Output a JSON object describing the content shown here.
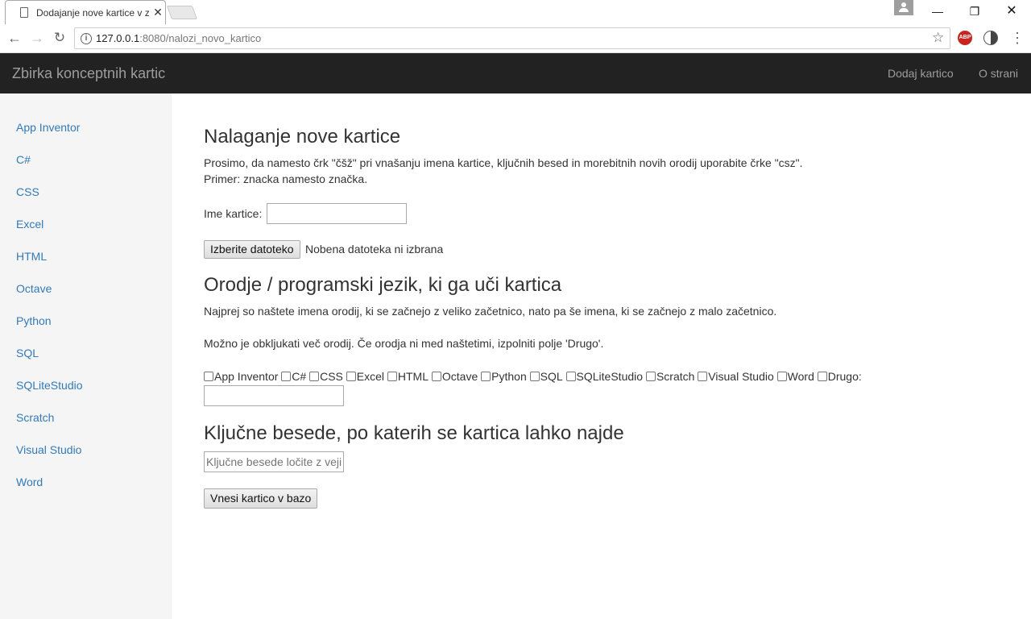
{
  "browser": {
    "tab_title": "Dodajanje nove kartice v zbirko",
    "url_host": "127.0.0.1",
    "url_path": ":8080/nalozi_novo_kartico"
  },
  "navbar": {
    "brand": "Zbirka konceptnih kartic",
    "links": [
      "Dodaj kartico",
      "O strani"
    ]
  },
  "sidebar": {
    "items": [
      "App Inventor",
      "C#",
      "CSS",
      "Excel",
      "HTML",
      "Octave",
      "Python",
      "SQL",
      "SQLiteStudio",
      "Scratch",
      "Visual Studio",
      "Word"
    ]
  },
  "form": {
    "heading": "Nalaganje nove kartice",
    "intro_line1": "Prosimo, da namesto črk \"čšž\" pri vnašanju imena kartice, ključnih besed in morebitnih novih orodij uporabite črke \"csz\".",
    "intro_line2": "Primer: znacka namesto značka.",
    "name_label": "Ime kartice:",
    "name_value": "",
    "file_button": "Izberite datoteko",
    "file_status": "Nobena datoteka ni izbrana",
    "tools_heading": "Orodje / programski jezik, ki ga uči kartica",
    "tools_note1": "Najprej so naštete imena orodij, ki se začnejo z veliko začetnico, nato pa še imena, ki se začnejo z malo začetnico.",
    "tools_note2": "Možno je obkljukati več orodij. Če orodja ni med naštetimi, izpolniti polje 'Drugo'.",
    "tools": [
      "App Inventor",
      "C#",
      "CSS",
      "Excel",
      "HTML",
      "Octave",
      "Python",
      "SQL",
      "SQLiteStudio",
      "Scratch",
      "Visual Studio",
      "Word",
      "Drugo:"
    ],
    "other_value": "",
    "keywords_heading": "Ključne besede, po katerih se kartica lahko najde",
    "keywords_placeholder": "Ključne besede ločite z vejico",
    "submit_button": "Vnesi kartico v bazo"
  }
}
